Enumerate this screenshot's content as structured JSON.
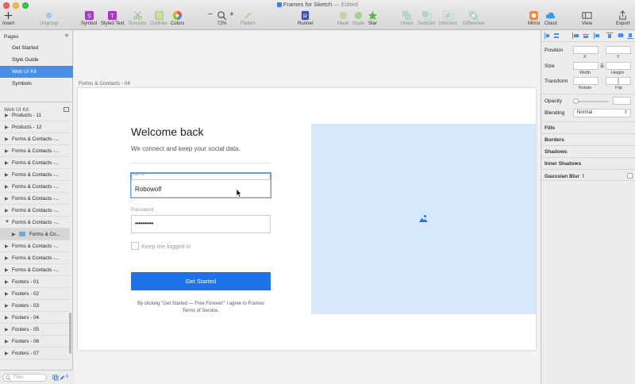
{
  "window": {
    "title": "Frames for Sketch",
    "status": "— Edited"
  },
  "toolbar": {
    "insert": "Insert",
    "ungroup": "Ungroup",
    "symbol": "Symbol",
    "styled_text": "Styled Text",
    "scissors": "Scissors",
    "outlines": "Outlines",
    "colors": "Colors",
    "zoom_minus": "−",
    "zoom_plus": "+",
    "zoom_level": "72%",
    "flatten": "Flatten",
    "runner": "Runner",
    "mask": "Mask",
    "scale": "Scale",
    "star": "Star",
    "union": "Union",
    "subtract": "Subtract",
    "intersect": "Intersect",
    "difference": "Difference",
    "mirror": "Mirror",
    "cloud": "Cloud",
    "view": "View",
    "export": "Export"
  },
  "pages": {
    "header": "Pages",
    "add": "+",
    "items": [
      {
        "label": "Get Started",
        "selected": false
      },
      {
        "label": "Style Guide",
        "selected": false
      },
      {
        "label": "Web UI Kit",
        "selected": true
      },
      {
        "label": "Symbols",
        "selected": false
      }
    ]
  },
  "layers": {
    "header": "Web UI Kit",
    "items": [
      {
        "label": "Products - 11"
      },
      {
        "label": "Products - 12"
      },
      {
        "label": "Forms & Contacts -..."
      },
      {
        "label": "Forms & Contacts -..."
      },
      {
        "label": "Forms & Contacts -..."
      },
      {
        "label": "Forms & Contacts -..."
      },
      {
        "label": "Forms & Contacts -..."
      },
      {
        "label": "Forms & Contacts -..."
      },
      {
        "label": "Forms & Contacts -..."
      },
      {
        "label": "Forms & Contacts -...",
        "expanded": true
      },
      {
        "label": "Forms & Co...",
        "child": true
      },
      {
        "label": "Forms & Contacts -..."
      },
      {
        "label": "Forms & Contacts -..."
      },
      {
        "label": "Forms & Contacts -..."
      },
      {
        "label": "Footers - 01"
      },
      {
        "label": "Footers - 02"
      },
      {
        "label": "Footers - 03"
      },
      {
        "label": "Footers - 04"
      },
      {
        "label": "Footers - 05"
      },
      {
        "label": "Footers - 06"
      },
      {
        "label": "Footers - 07"
      }
    ],
    "filter_placeholder": "Filter",
    "footer_count": "6"
  },
  "artboard": {
    "label": "Forms & Contacts - 04",
    "heading": "Welcome back",
    "subheading": "We connect and keep your social data.",
    "name_label": "Name",
    "name_value": "Robowolf",
    "password_label": "Password",
    "password_value": "••••••••••",
    "remember_label": "Keep me logged in",
    "submit_label": "Get Started",
    "terms_line1": "By clicking \"Get Started — Free Forever!\" I agree to Frames",
    "terms_line2": "Terms of Service."
  },
  "inspector": {
    "position": "Position",
    "x": "X",
    "y": "Y",
    "size": "Size",
    "width": "Width",
    "height": "Height",
    "transform": "Transform",
    "rotate": "Rotate",
    "flip": "Flip",
    "opacity": "Opacity",
    "blending": "Blending",
    "blending_value": "Normal",
    "fills": "Fills",
    "borders": "Borders",
    "shadows": "Shadows",
    "inner_shadows": "Inner Shadows",
    "gaussian_blur": "Gaussian Blur"
  },
  "colors": {
    "accent": "#1f73e8",
    "selection": "#4a8ee6",
    "image_placeholder": "#d7e8fb"
  }
}
